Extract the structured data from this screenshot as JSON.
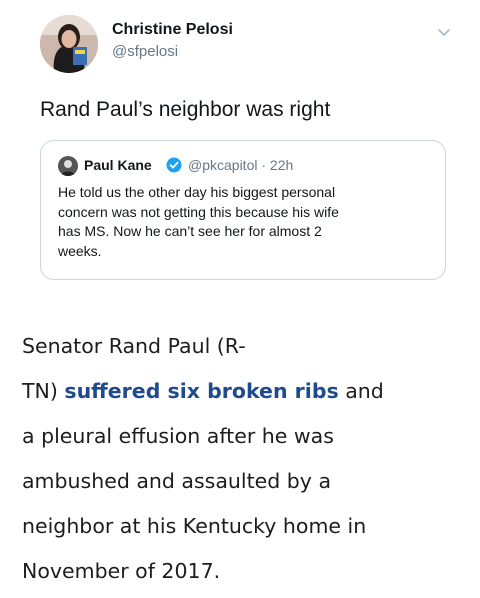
{
  "tweet": {
    "author_name": "Christine Pelosi",
    "author_handle": "@sfpelosi",
    "text": "Rand Paul’s neighbor was right",
    "avatar_icon": "profile-photo-icon",
    "menu_icon": "chevron-down-icon"
  },
  "quoted": {
    "author_name": "Paul Kane",
    "author_handle": "@pkcapitol",
    "separator": "·",
    "time": "22h",
    "verified_icon": "verified-badge-icon",
    "body_lines": [
      "He told us the other day his biggest personal",
      "concern was not getting this because his wife",
      "has MS. Now he can’t see her for almost 2",
      "weeks."
    ]
  },
  "article": {
    "line1": "Senator Rand Paul (R-",
    "line2_prefix": "TN) ",
    "line2_link": "suffered six broken ribs",
    "line2_suffix": " and",
    "line3": "a pleural effusion after he was",
    "line4": "ambushed and assaulted by a",
    "line5": "neighbor at his Kentucky home in",
    "line6": "November of 2017."
  },
  "colors": {
    "link": "#1f4a8c",
    "verified": "#1da1f2",
    "secondary_text": "#657786",
    "border": "#ccd6dd"
  }
}
